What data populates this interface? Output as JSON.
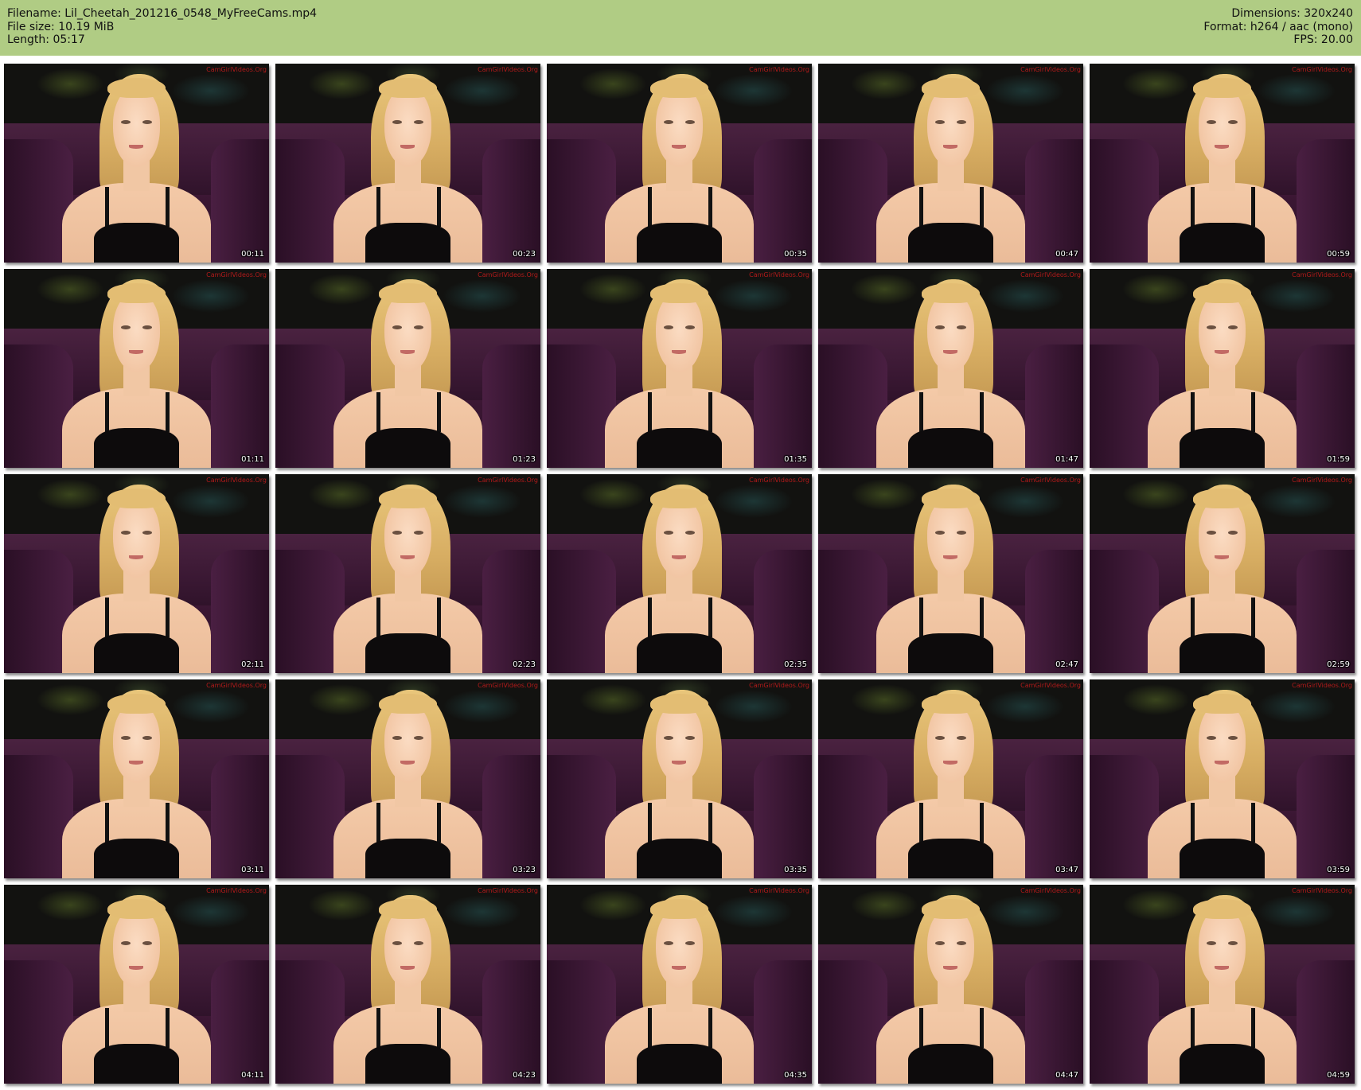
{
  "colors": {
    "header_background": "#b0cc84",
    "header_text": "#111111",
    "page_background": "#ffffff",
    "timestamp_text": "#ffffff",
    "watermark_text": "#b11a1a"
  },
  "header": {
    "filename": "Filename: Lil_Cheetah_201216_0548_MyFreeCams.mp4",
    "file_size": "File size: 10.19 MiB",
    "length": "Length: 05:17",
    "dimensions": "Dimensions: 320x240",
    "format": "Format: h264 / aac (mono)",
    "fps": "FPS: 20.00"
  },
  "thumbnails": [
    {
      "time": "00:11",
      "watermark": "CamGirlVideos.Org"
    },
    {
      "time": "00:23",
      "watermark": "CamGirlVideos.Org"
    },
    {
      "time": "00:35",
      "watermark": "CamGirlVideos.Org"
    },
    {
      "time": "00:47",
      "watermark": "CamGirlVideos.Org"
    },
    {
      "time": "00:59",
      "watermark": "CamGirlVideos.Org"
    },
    {
      "time": "01:11",
      "watermark": "CamGirlVideos.Org"
    },
    {
      "time": "01:23",
      "watermark": "CamGirlVideos.Org"
    },
    {
      "time": "01:35",
      "watermark": "CamGirlVideos.Org"
    },
    {
      "time": "01:47",
      "watermark": "CamGirlVideos.Org"
    },
    {
      "time": "01:59",
      "watermark": "CamGirlVideos.Org"
    },
    {
      "time": "02:11",
      "watermark": "CamGirlVideos.Org"
    },
    {
      "time": "02:23",
      "watermark": "CamGirlVideos.Org"
    },
    {
      "time": "02:35",
      "watermark": "CamGirlVideos.Org"
    },
    {
      "time": "02:47",
      "watermark": "CamGirlVideos.Org"
    },
    {
      "time": "02:59",
      "watermark": "CamGirlVideos.Org"
    },
    {
      "time": "03:11",
      "watermark": "CamGirlVideos.Org"
    },
    {
      "time": "03:23",
      "watermark": "CamGirlVideos.Org"
    },
    {
      "time": "03:35",
      "watermark": "CamGirlVideos.Org"
    },
    {
      "time": "03:47",
      "watermark": "CamGirlVideos.Org"
    },
    {
      "time": "03:59",
      "watermark": "CamGirlVideos.Org"
    },
    {
      "time": "04:11",
      "watermark": "CamGirlVideos.Org"
    },
    {
      "time": "04:23",
      "watermark": "CamGirlVideos.Org"
    },
    {
      "time": "04:35",
      "watermark": "CamGirlVideos.Org"
    },
    {
      "time": "04:47",
      "watermark": "CamGirlVideos.Org"
    },
    {
      "time": "04:59",
      "watermark": "CamGirlVideos.Org"
    }
  ]
}
